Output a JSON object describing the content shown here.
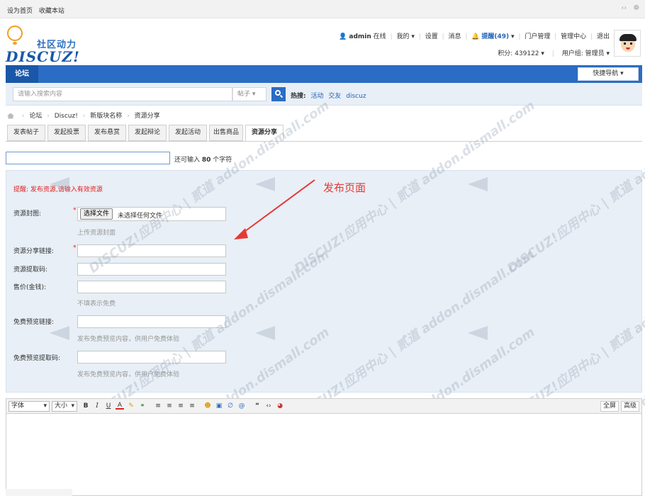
{
  "topbar": {
    "links": [
      "设为首页",
      "收藏本站"
    ]
  },
  "logo": {
    "cn": "社区动力",
    "en": "DISCUZ!"
  },
  "user": {
    "name": "admin",
    "status": "在线",
    "menu": [
      "我的",
      "设置",
      "消息"
    ],
    "remind": "提醒(49)",
    "links": [
      "门户管理",
      "管理中心",
      "退出"
    ],
    "credits": "积分: 439122",
    "group": "用户组: 管理员"
  },
  "nav": {
    "forum": "论坛",
    "quick": "快捷导航"
  },
  "search": {
    "placeholder": "请输入搜索内容",
    "type": "帖子",
    "hot_label": "热搜:",
    "hot_words": [
      "活动",
      "交友",
      "discuz"
    ]
  },
  "breadcrumb": [
    "论坛",
    "Discuz!",
    "新版块名称",
    "资源分享"
  ],
  "tabs": [
    "发表帖子",
    "发起投票",
    "发布悬赏",
    "发起辩论",
    "发起活动",
    "出售商品",
    "资源分享"
  ],
  "title_hint": {
    "prefix": "还可输入",
    "count": "80",
    "suffix": "个字符"
  },
  "form": {
    "notice": "提醒: 发布资源,请输入有效资源",
    "cover_label": "资源封图:",
    "file_button": "选择文件",
    "file_status": "未选择任何文件",
    "cover_hint": "上传资源封面",
    "link_label": "资源分享链接:",
    "code_label": "资源提取码:",
    "price_label": "售价(金钱):",
    "price_hint": "不填表示免费",
    "preview_link_label": "免费预览链接:",
    "preview_link_hint": "发布免费预览内容，供用户免费体验",
    "preview_code_label": "免费预览提取码:",
    "preview_code_hint": "发布免费预览内容，供用户免费体验",
    "required_mark": "*"
  },
  "annotation": "发布页面",
  "editor": {
    "font": "字体",
    "size": "大小",
    "fullscreen": "全屏",
    "advanced": "高级"
  },
  "watermark": "DISCUZ!应用中心 | 贰道 addon.dismall.com",
  "colors": {
    "nav_blue": "#2b6cc4",
    "notice_red": "#e02020",
    "annotation_red": "#e53935",
    "form_bg": "#e8eff6"
  }
}
